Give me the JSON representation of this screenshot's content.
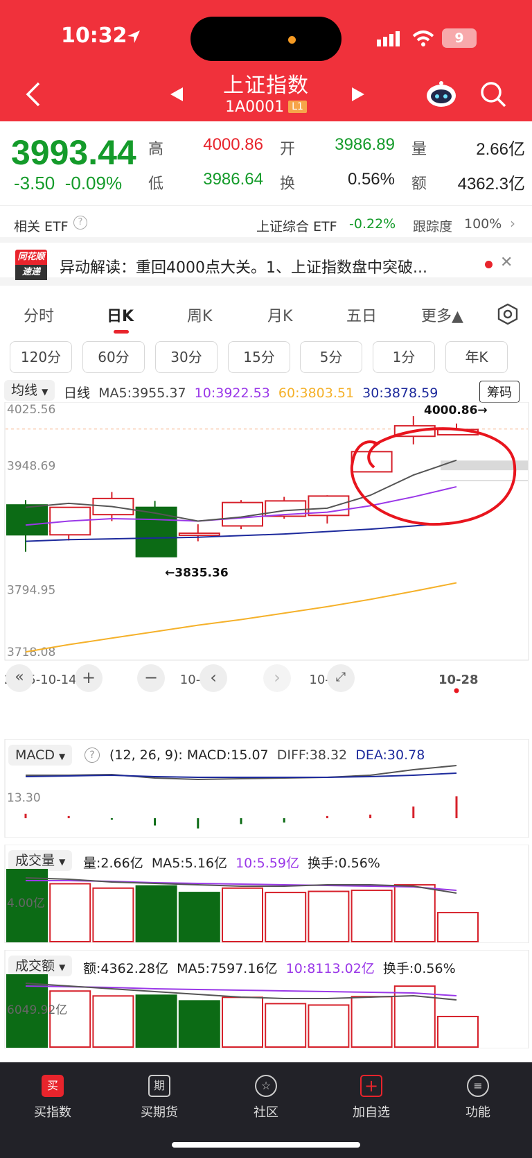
{
  "status": {
    "time": "10:32",
    "battery": "9"
  },
  "header": {
    "title": "上证指数",
    "code": "1A0001",
    "badge": "L1"
  },
  "quote": {
    "price": "3993.44",
    "change": "-3.50",
    "change_pct": "-0.09%",
    "high_label": "高",
    "high": "4000.86",
    "open_label": "开",
    "open": "3986.89",
    "vol_label": "量",
    "vol": "2.66亿",
    "low_label": "低",
    "low": "3986.64",
    "turnover_label": "换",
    "turnover": "0.56%",
    "amount_label": "额",
    "amount": "4362.3亿"
  },
  "etf": {
    "label": "相关 ETF",
    "name": "上证综合 ETF",
    "pct": "-0.22%",
    "track_label": "跟踪度",
    "track": "100%"
  },
  "news": {
    "logo_top": "同花顺",
    "logo_bottom": "速递",
    "text": "异动解读：重回4000点大关。1、上证指数盘中突破..."
  },
  "tabs": [
    {
      "label": "分时"
    },
    {
      "label": "日K"
    },
    {
      "label": "周K"
    },
    {
      "label": "月K"
    },
    {
      "label": "五日"
    },
    {
      "label": "更多▲"
    }
  ],
  "periods": [
    {
      "label": "120分"
    },
    {
      "label": "60分"
    },
    {
      "label": "30分"
    },
    {
      "label": "15分"
    },
    {
      "label": "5分"
    },
    {
      "label": "1分"
    },
    {
      "label": "年K"
    }
  ],
  "kline_header": {
    "ma_toggle": "均线",
    "line_type": "日线",
    "ma5": "MA5:3955.37",
    "ma10": "10:3922.53",
    "ma60": "60:3803.51",
    "ma30": "30:3878.59",
    "chips": "筹码"
  },
  "colors": {
    "up": "#d6202a",
    "down": "#0c6b15",
    "ma5": "#555555",
    "ma10": "#9a38e8",
    "ma30": "#1d2a9c",
    "ma60": "#f5b12a",
    "annot": "#e8151e"
  },
  "chart_data": {
    "type": "candlestick",
    "y_ticks": [
      "4025.56",
      "3948.69",
      "3871.82",
      "3794.95",
      "3718.08"
    ],
    "ylim": [
      3718.08,
      4025.56
    ],
    "x_ticks": [
      "2025-10-14",
      "10-20",
      "10-23",
      "10-28"
    ],
    "annotations": {
      "high": "4000.86→",
      "low": "←3835.36"
    },
    "candles": [
      {
        "o": 3900,
        "c": 3863,
        "h": 3906,
        "l": 3842
      },
      {
        "o": 3863,
        "c": 3897,
        "h": 3897,
        "l": 3856
      },
      {
        "o": 3888,
        "c": 3908,
        "h": 3916,
        "l": 3880
      },
      {
        "o": 3897,
        "c": 3836,
        "h": 3905,
        "l": 3835.36
      },
      {
        "o": 3863,
        "c": 3865,
        "h": 3876,
        "l": 3855
      },
      {
        "o": 3874,
        "c": 3903,
        "h": 3906,
        "l": 3870
      },
      {
        "o": 3886,
        "c": 3905,
        "h": 3910,
        "l": 3883
      },
      {
        "o": 3887,
        "c": 3911,
        "h": 3912,
        "l": 3877
      },
      {
        "o": 3941,
        "c": 3966,
        "h": 3966,
        "l": 3941
      },
      {
        "o": 3985,
        "c": 3998,
        "h": 4010,
        "l": 3975
      },
      {
        "o": 3986.89,
        "c": 3993.44,
        "h": 4000.86,
        "l": 3986.64
      }
    ],
    "ma5": [
      3897,
      3902,
      3898,
      3890,
      3880,
      3885,
      3893,
      3896,
      3912,
      3937,
      3955.37
    ],
    "ma10": [
      3875,
      3880,
      3883,
      3882,
      3880,
      3884,
      3888,
      3891,
      3899,
      3910,
      3922.53
    ],
    "ma30": [
      3855,
      3857,
      3858,
      3859,
      3860,
      3862,
      3864,
      3867,
      3870,
      3874,
      3878.59
    ],
    "ma60": [
      3718,
      3727,
      3735,
      3743,
      3751,
      3758,
      3766,
      3774,
      3783,
      3793,
      3803.51
    ],
    "macd": {
      "header": "MACD",
      "params": "(12, 26, 9):",
      "macd": "MACD:15.07",
      "diff": "DIFF:38.32",
      "dea": "DEA:30.78",
      "tick": "13.30",
      "bars": [
        3.0,
        1.5,
        -1.0,
        -5.0,
        -7.0,
        -4.0,
        -3.0,
        1.5,
        2.5,
        8.0,
        15.07
      ]
    },
    "volume": {
      "header": "成交量",
      "vol": "量:2.66亿",
      "ma5": "MA5:5.16亿",
      "ma10": "10:5.59亿",
      "turnover": "换手:0.56%",
      "tick": "4.00亿",
      "bars": [
        6.6,
        5.3,
        4.9,
        5.1,
        4.5,
        4.9,
        4.5,
        4.6,
        4.7,
        5.2,
        2.66
      ],
      "up": [
        false,
        true,
        true,
        false,
        false,
        true,
        true,
        true,
        true,
        true,
        true
      ]
    },
    "amount": {
      "header": "成交额",
      "amt": "额:4362.28亿",
      "ma5": "MA5:7597.16亿",
      "ma10": "10:8113.02亿",
      "turnover": "换手:0.56%",
      "tick": "6049.92亿",
      "bars": [
        10300,
        8000,
        7300,
        7400,
        6600,
        7100,
        6200,
        6000,
        7200,
        8700,
        4362.28
      ],
      "up": [
        false,
        true,
        true,
        false,
        false,
        true,
        true,
        true,
        true,
        true,
        true
      ]
    }
  },
  "bottom_bar": [
    {
      "label": "买指数",
      "icon": "买"
    },
    {
      "label": "买期货",
      "icon": "期"
    },
    {
      "label": "社区",
      "icon": "☆"
    },
    {
      "label": "加自选",
      "icon": "+"
    },
    {
      "label": "功能",
      "icon": "≡"
    }
  ]
}
